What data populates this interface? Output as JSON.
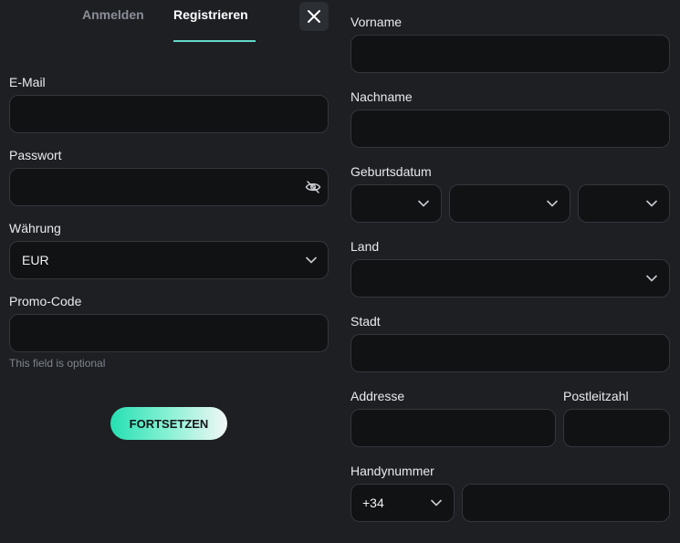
{
  "tabs": {
    "login": "Anmelden",
    "register": "Registrieren"
  },
  "close_icon": "close-icon",
  "left_form": {
    "email_label": "E-Mail",
    "password_label": "Passwort",
    "currency_label": "Währung",
    "currency_value": "EUR",
    "promo_label": "Promo-Code",
    "promo_hint": "This field is optional",
    "submit_label": "FORTSETZEN"
  },
  "right_form": {
    "first_name_label": "Vorname",
    "last_name_label": "Nachname",
    "birthdate_label": "Geburtsdatum",
    "country_label": "Land",
    "city_label": "Stadt",
    "address_label": "Addresse",
    "postcode_label": "Postleitzahl",
    "phone_label": "Handynummer",
    "phone_prefix": "+34"
  },
  "icons": {
    "password_toggle": "eye-off-icon",
    "dropdown": "chevron-down-icon"
  },
  "colors": {
    "background": "#1d1f23",
    "field_background": "#111214",
    "accent": "#63d9c8",
    "cta_start": "#25dfb2"
  }
}
